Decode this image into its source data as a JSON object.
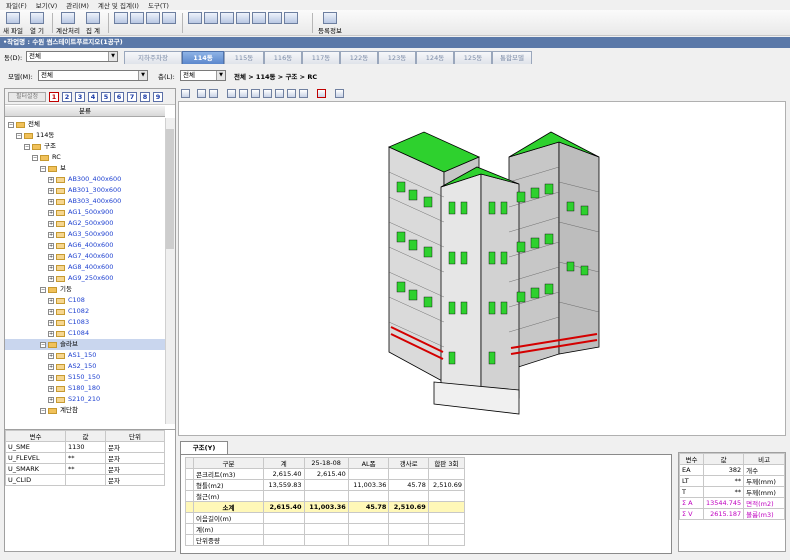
{
  "menu": [
    "파일(F)",
    "보기(V)",
    "관리(M)",
    "계산 및 집계(I)",
    "도구(T)"
  ],
  "toolbar": {
    "new_file": "새 파일",
    "open": "열 기",
    "calculate": "계산처리",
    "tally": "집 계",
    "register": "등록정보"
  },
  "title_bar": "•작업명 : 수원 썸스테이트푸르지오(1공구)",
  "building": {
    "label": "동(D):",
    "value": "전체",
    "tabs": [
      "지하주차장",
      "114동",
      "115동",
      "116동",
      "117동",
      "122동",
      "123동",
      "124동",
      "125동",
      "통합모델"
    ],
    "active_tab": "114동"
  },
  "model": {
    "label": "모델(M):",
    "value": "전체",
    "floor_label": "층(L):",
    "floor_value": "전체",
    "breadcrumb": "전체 > 114동 > 구조 > RC"
  },
  "left_panel": {
    "filter_label": "필터설정",
    "numbers": [
      "1",
      "2",
      "3",
      "4",
      "5",
      "6",
      "7",
      "8",
      "9"
    ],
    "tree_header": "분류",
    "tree": [
      {
        "label": "전체",
        "level": 0,
        "type": "folder"
      },
      {
        "label": "114동",
        "level": 1,
        "type": "folder"
      },
      {
        "label": "구조",
        "level": 2,
        "type": "folder"
      },
      {
        "label": "RC",
        "level": 3,
        "type": "folder"
      },
      {
        "label": "보",
        "level": 4,
        "type": "folder"
      },
      {
        "label": "AB300_400x600",
        "level": 5,
        "type": "leaf"
      },
      {
        "label": "AB301_300x600",
        "level": 5,
        "type": "leaf"
      },
      {
        "label": "AB303_400x600",
        "level": 5,
        "type": "leaf"
      },
      {
        "label": "AG1_500x900",
        "level": 5,
        "type": "leaf"
      },
      {
        "label": "AG2_500x900",
        "level": 5,
        "type": "leaf"
      },
      {
        "label": "AG3_500x900",
        "level": 5,
        "type": "leaf"
      },
      {
        "label": "AG6_400x600",
        "level": 5,
        "type": "leaf"
      },
      {
        "label": "AG7_400x600",
        "level": 5,
        "type": "leaf"
      },
      {
        "label": "AG8_400x600",
        "level": 5,
        "type": "leaf"
      },
      {
        "label": "AG9_250x600",
        "level": 5,
        "type": "leaf"
      },
      {
        "label": "기둥",
        "level": 4,
        "type": "folder"
      },
      {
        "label": "C108",
        "level": 5,
        "type": "leaf"
      },
      {
        "label": "C1082",
        "level": 5,
        "type": "leaf"
      },
      {
        "label": "C1083",
        "level": 5,
        "type": "leaf"
      },
      {
        "label": "C1084",
        "level": 5,
        "type": "leaf"
      },
      {
        "label": "슬라브",
        "level": 4,
        "type": "folder",
        "selected": true
      },
      {
        "label": "AS1_150",
        "level": 5,
        "type": "leaf"
      },
      {
        "label": "AS2_150",
        "level": 5,
        "type": "leaf"
      },
      {
        "label": "S150_150",
        "level": 5,
        "type": "leaf"
      },
      {
        "label": "S180_180",
        "level": 5,
        "type": "leaf"
      },
      {
        "label": "S210_210",
        "level": 5,
        "type": "leaf"
      },
      {
        "label": "계단참",
        "level": 4,
        "type": "folder"
      }
    ],
    "var_table": {
      "headers": [
        "변수",
        "값",
        "단위"
      ],
      "rows": [
        [
          "U_SME",
          "1130",
          "문자"
        ],
        [
          "U_FLEVEL",
          "**",
          "문자"
        ],
        [
          "U_SMARK",
          "**",
          "문자"
        ],
        [
          "U_CLID",
          "",
          "문자"
        ]
      ]
    }
  },
  "bottom": {
    "tab": "구조(Y)",
    "headers": [
      "구분",
      "계",
      "25-18-08",
      "AL폼",
      "갱사로",
      "합판 3회"
    ],
    "rows": [
      {
        "cells": [
          "콘크리트(m3)",
          "2,615.40",
          "2,615.40",
          "",
          "",
          ""
        ]
      },
      {
        "cells": [
          "형틀(m2)",
          "13,559.83",
          "",
          "11,003.36",
          "45.78",
          "2,510.69"
        ]
      },
      {
        "cells": [
          "철근(m)",
          "",
          "",
          "",
          "",
          ""
        ]
      },
      {
        "cells": [
          "소계",
          "2,615.40",
          "11,003.36",
          "45.78",
          "2,510.69",
          ""
        ],
        "highlight": true
      },
      {
        "cells": [
          "이음길이(m)",
          "",
          "",
          "",
          "",
          ""
        ]
      },
      {
        "cells": [
          "계(m)",
          "",
          "",
          "",
          "",
          ""
        ]
      },
      {
        "cells": [
          "단위중량",
          "",
          "",
          "",
          "",
          ""
        ]
      }
    ]
  },
  "right_table": {
    "headers": [
      "변수",
      "값",
      "비고"
    ],
    "rows": [
      {
        "cells": [
          "EA",
          "382",
          "개수"
        ]
      },
      {
        "cells": [
          "LT",
          "**",
          "두께(mm)"
        ]
      },
      {
        "cells": [
          "T",
          "**",
          "두께(mm)"
        ]
      },
      {
        "cells": [
          "Σ A",
          "13544.745",
          "면적(m2)"
        ],
        "magenta": true
      },
      {
        "cells": [
          "Σ V",
          "2615.187",
          "볼륨(m3)"
        ],
        "magenta": true
      }
    ]
  },
  "colors": {
    "slab": "#2ed12e",
    "wall": "#d9d9d9",
    "edge": "#000000",
    "beam_red": "#d40000",
    "tab_active": "#5b87cc",
    "title_bar": "#5a78a8"
  }
}
